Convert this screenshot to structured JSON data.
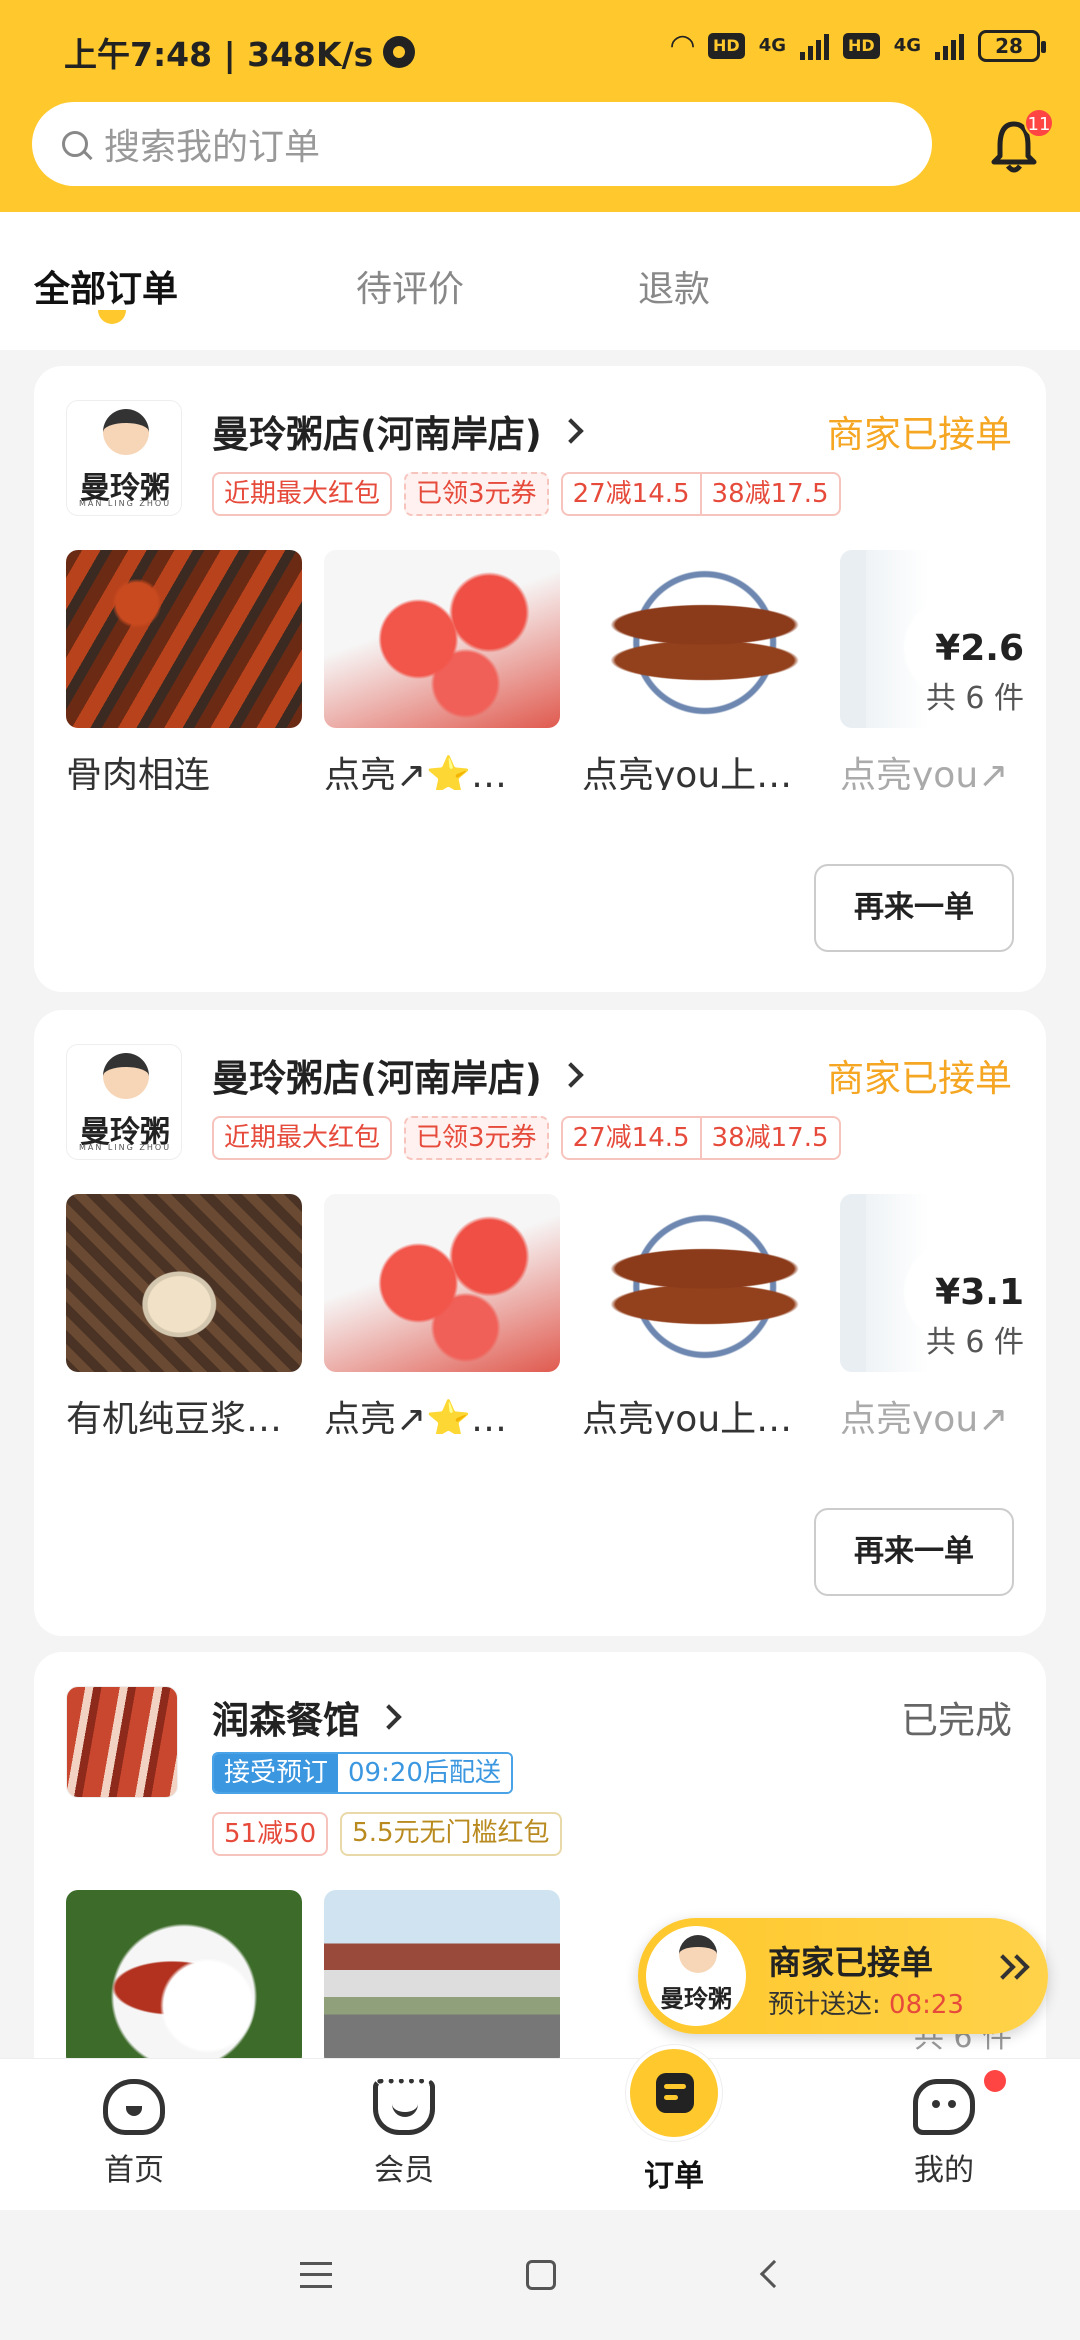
{
  "status_bar": {
    "time_speed": "上午7:48 | 348K/s",
    "hd": "HD",
    "net": "4G",
    "battery": "28"
  },
  "search": {
    "placeholder": "搜索我的订单"
  },
  "notifications": {
    "badge": "11"
  },
  "tabs": [
    {
      "label": "全部订单",
      "active": true
    },
    {
      "label": "待评价",
      "active": false
    },
    {
      "label": "退款",
      "active": false
    }
  ],
  "orders": [
    {
      "shop_logo_text": "曼玲粥",
      "shop_logo_sub": "MAN LING ZHOU",
      "shop_name": "曼玲粥店(河南岸店)",
      "status": "商家已接单",
      "tags": [
        "近期最大红包",
        "已领3元券",
        "27减14.5",
        "38减17.5"
      ],
      "items": [
        "骨肉相连",
        "点亮↗⭐…",
        "点亮you上…",
        "点亮you↗"
      ],
      "price": "¥2.6",
      "count": "共 6 件",
      "reorder": "再来一单"
    },
    {
      "shop_logo_text": "曼玲粥",
      "shop_logo_sub": "MAN LING ZHOU",
      "shop_name": "曼玲粥店(河南岸店)",
      "status": "商家已接单",
      "tags": [
        "近期最大红包",
        "已领3元券",
        "27减14.5",
        "38减17.5"
      ],
      "items": [
        "有机纯豆浆…",
        "点亮↗⭐…",
        "点亮you上…",
        "点亮you↗"
      ],
      "price": "¥3.1",
      "count": "共 6 件",
      "reorder": "再来一单"
    },
    {
      "shop_name": "润森餐馆",
      "status": "已完成",
      "preorder": "接受预订",
      "delivery_time": "09:20后配送",
      "tags": [
        "51减50",
        "5.5元无门槛红包"
      ],
      "count": "共 6 件"
    }
  ],
  "floating": {
    "logo_text": "曼玲粥",
    "title": "商家已接单",
    "eta_label": "预计送达: ",
    "eta_time": "08:23"
  },
  "bottom_nav": [
    {
      "label": "首页"
    },
    {
      "label": "会员"
    },
    {
      "label": "订单"
    },
    {
      "label": "我的"
    }
  ]
}
